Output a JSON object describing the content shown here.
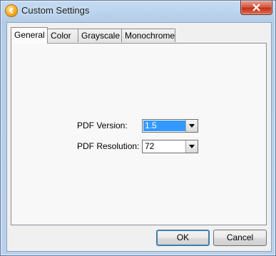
{
  "window": {
    "title": "Custom Settings",
    "icon": "app-icon"
  },
  "tabs": [
    {
      "label": "General",
      "active": true
    },
    {
      "label": "Color",
      "active": false
    },
    {
      "label": "Grayscale",
      "active": false
    },
    {
      "label": "Monochrome",
      "active": false
    }
  ],
  "general": {
    "pdf_version_label": "PDF Version:",
    "pdf_version_value": "1.5",
    "pdf_resolution_label": "PDF Resolution:",
    "pdf_resolution_value": "72"
  },
  "buttons": {
    "ok": "OK",
    "cancel": "Cancel"
  },
  "colors": {
    "accent": "#3399ff",
    "close": "#c4321d"
  }
}
